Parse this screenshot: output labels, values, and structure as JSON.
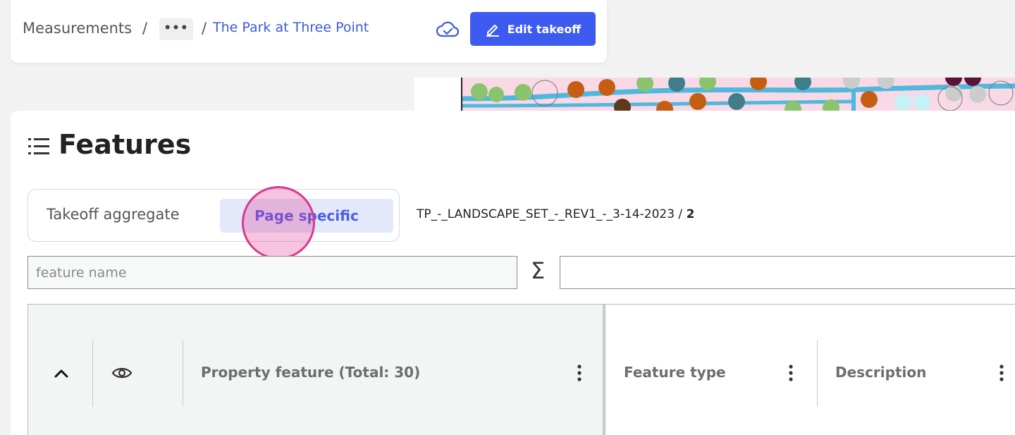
{
  "breadcrumb": {
    "root": "Measurements",
    "separator": "/",
    "more": "•••",
    "current": "The Park at Three Point"
  },
  "toolbar": {
    "edit_label": "Edit takeoff"
  },
  "panel": {
    "title": "Features",
    "segments": {
      "aggregate": "Takeoff aggregate",
      "page": "Page specific",
      "active": "page"
    },
    "document_path": "TP_-_LANDSCAPE_SET_-_REV1_-_3-14-2023 /",
    "page_number": "2",
    "filter_placeholder": "feature name",
    "sigma": "Σ"
  },
  "table": {
    "columns": [
      {
        "label": "Property feature (Total: 30)"
      },
      {
        "label": "Feature type"
      },
      {
        "label": "Description"
      }
    ]
  },
  "colors": {
    "accent": "#3d5bf0",
    "link": "#3b5bdb",
    "segment_active_bg": "#e3e8fb",
    "click_marker": "#d63c8f"
  }
}
